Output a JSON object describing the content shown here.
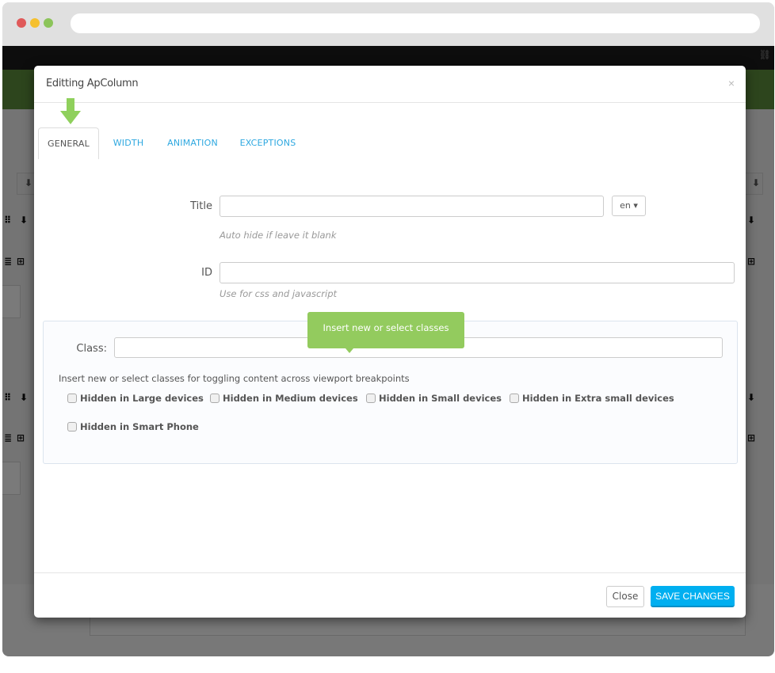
{
  "browser": {
    "window_controls": [
      "close",
      "minimize",
      "maximize"
    ],
    "url": ""
  },
  "background": {
    "icons": [
      "move-grid-icon",
      "arrow-circle-down-icon",
      "list-icon",
      "plus-square-icon"
    ]
  },
  "modal": {
    "title": "Editting ApColumn",
    "close_glyph": "×",
    "tabs": [
      {
        "label": "GENERAL",
        "active": true
      },
      {
        "label": "WIDTH",
        "active": false
      },
      {
        "label": "ANIMATION",
        "active": false
      },
      {
        "label": "EXCEPTIONS",
        "active": false
      }
    ],
    "form": {
      "title": {
        "label": "Title",
        "value": "",
        "help": "Auto hide if leave it blank",
        "lang": "en"
      },
      "id": {
        "label": "ID",
        "value": "",
        "help": "Use for css and javascript"
      },
      "class": {
        "label": "Class:",
        "value": "",
        "tooltip": "Insert new or select classes",
        "hint": "Insert new or select classes for toggling content across viewport breakpoints",
        "checkboxes": [
          {
            "label": "Hidden in Large devices",
            "checked": false
          },
          {
            "label": "Hidden in Medium devices",
            "checked": false
          },
          {
            "label": "Hidden in Small devices",
            "checked": false
          },
          {
            "label": "Hidden in Extra small devices",
            "checked": false
          },
          {
            "label": "Hidden in Smart Phone",
            "checked": false
          }
        ]
      }
    },
    "footer": {
      "close_label": "Close",
      "save_label": "SAVE CHANGES"
    }
  },
  "colors": {
    "accent_blue": "#00aff0",
    "tab_link": "#2ea8e0",
    "tooltip_green": "#93cb5e",
    "arrow_green": "#8fd05c",
    "header_green": "#5b8b3a"
  }
}
